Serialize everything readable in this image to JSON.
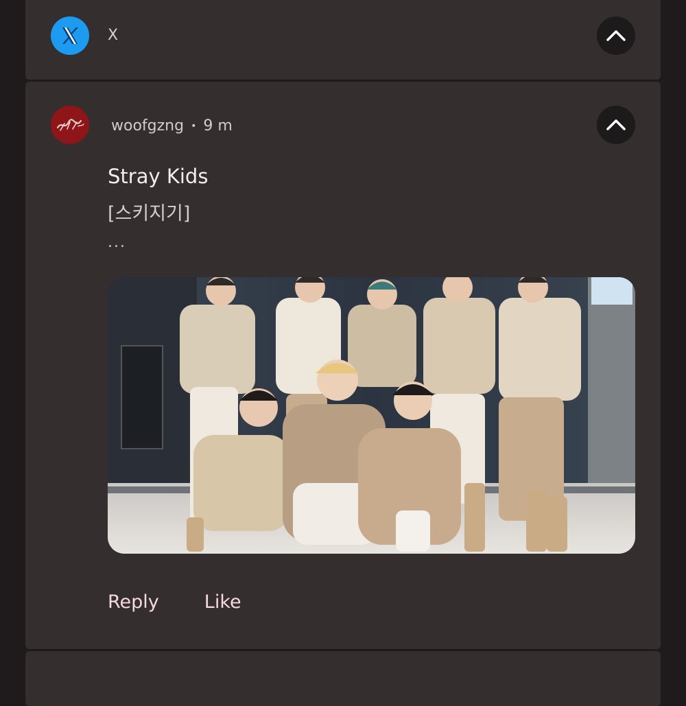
{
  "notification_x": {
    "app_name": "X",
    "icon": "x-logo-icon",
    "collapse_icon": "chevron-up-icon"
  },
  "notification_post": {
    "username": "woofgzng",
    "separator": "•",
    "time_ago": "9 m",
    "avatar_icon": "stray-kids-logo-icon",
    "collapse_icon": "chevron-up-icon",
    "title": "Stray Kids",
    "body": "[스키지기]",
    "more": "...",
    "image_alt": "group-photo",
    "actions": {
      "reply_label": "Reply",
      "like_label": "Like"
    }
  },
  "colors": {
    "background": "#1f1b1c",
    "card": "#342e2f",
    "x_brand": "#1d9bf0",
    "avatar_red": "#8e1518",
    "action_text": "#f6d8e3"
  }
}
